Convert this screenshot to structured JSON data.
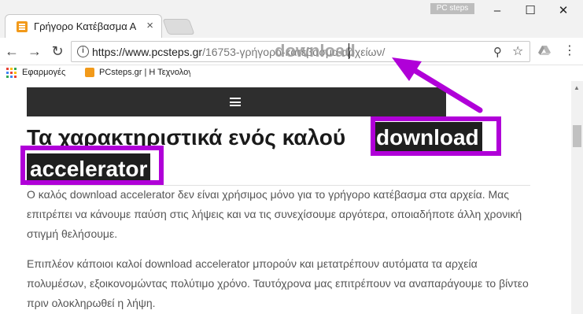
{
  "browser": {
    "tab_title": "Γρήγορο Κατέβασμα Αρχείων",
    "tab_close": "×",
    "profile_badge": "PC steps",
    "window_minimize": "–",
    "window_maximize": "☐",
    "window_close": "✕"
  },
  "toolbar": {
    "back_icon": "←",
    "forward_icon": "→",
    "reload_icon": "↻",
    "info_icon": "i",
    "url_host": "https://www.pcsteps.gr",
    "url_path": "/16753-γρήγορο-κατέβασμα-αρχείων/",
    "url_overlay": "download",
    "zoom_icon": "⚲",
    "star_icon": "☆",
    "menu_icon": "⋮"
  },
  "bookmarks": {
    "apps_label": "Εφαρμογές",
    "site_label": "PCsteps.gr | Η Τεχνολογία"
  },
  "article": {
    "title_line1": "Τα χαρακτηριστικά ενός καλού",
    "title_highlight1": "download",
    "title_highlight2": "accelerator",
    "para1": "Ο καλός download accelerator δεν είναι χρήσιμος μόνο για το γρήγορο κατέβασμα στα αρχεία. Μας επιτρέπει να κάνουμε παύση στις λήψεις και να τις συνεχίσουμε αργότερα, οποιαδήποτε άλλη χρονική στιγμή θελήσουμε.",
    "para2": "Επιπλέον κάποιοι καλοί download accelerator μπορούν και μετατρέπουν αυτόματα τα αρχεία πολυμέσων, εξοικονομώντας πολύτιμο χρόνο. Ταυτόχρονα μας επιτρέπουν να αναπαράγουμε το βίντεο πριν ολοκληρωθεί η λήψη."
  },
  "colors": {
    "annotation": "#b000d8",
    "site_header": "#2e2e2e",
    "favicon": "#f29a1a"
  }
}
